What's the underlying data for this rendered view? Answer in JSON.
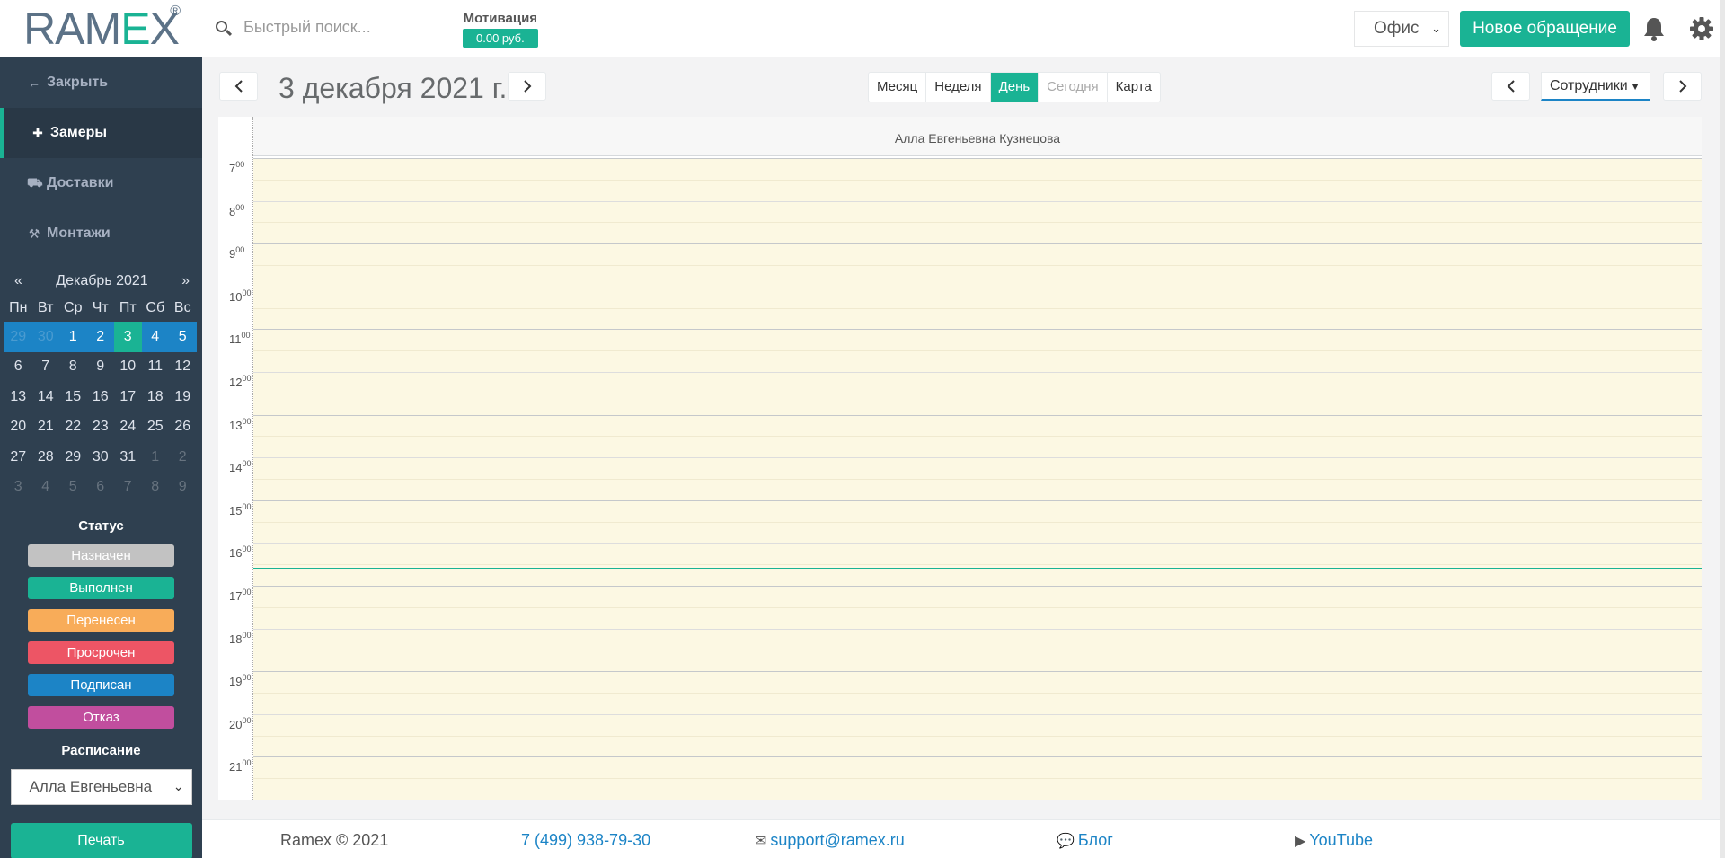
{
  "brand": {
    "logo_text": "RAMEX",
    "reg": "®"
  },
  "sidebar": {
    "nav": [
      {
        "label": "Закрыть",
        "icon": "arrow-left-icon"
      },
      {
        "label": "Замеры",
        "icon": "move-icon",
        "active": true
      },
      {
        "label": "Доставки",
        "icon": "truck-icon"
      },
      {
        "label": "Монтажи",
        "icon": "wrench-icon"
      }
    ],
    "mini_calendar": {
      "prev": "«",
      "next": "»",
      "month": "Декабрь 2021",
      "weekdays": [
        "Пн",
        "Вт",
        "Ср",
        "Чт",
        "Пт",
        "Сб",
        "Вс"
      ],
      "weeks": [
        [
          "29",
          "30",
          "1",
          "2",
          "3",
          "4",
          "5"
        ],
        [
          "6",
          "7",
          "8",
          "9",
          "10",
          "11",
          "12"
        ],
        [
          "13",
          "14",
          "15",
          "16",
          "17",
          "18",
          "19"
        ],
        [
          "20",
          "21",
          "22",
          "23",
          "24",
          "25",
          "26"
        ],
        [
          "27",
          "28",
          "29",
          "30",
          "31",
          "1",
          "2"
        ],
        [
          "3",
          "4",
          "5",
          "6",
          "7",
          "8",
          "9"
        ]
      ]
    },
    "status": {
      "title": "Статус",
      "items": [
        {
          "label": "Назначен",
          "color": "#c2c2c2"
        },
        {
          "label": "Выполнен",
          "color": "#1ab394"
        },
        {
          "label": "Перенесен",
          "color": "#f8ac59"
        },
        {
          "label": "Просрочен",
          "color": "#ed5565"
        },
        {
          "label": "Подписан",
          "color": "#1c84c6"
        },
        {
          "label": "Отказ",
          "color": "#c14e9e"
        }
      ]
    },
    "schedule": {
      "title": "Расписание",
      "selected": "Алла Евгеньевна"
    },
    "print_label": "Печать"
  },
  "topbar": {
    "search_placeholder": "Быстрый поиск...",
    "motivation": {
      "label": "Мотивация",
      "value": "0.00 руб."
    },
    "office": "Офис",
    "new_request": "Новое обращение"
  },
  "calendar": {
    "date_title": "3 декабря 2021 г.",
    "views": [
      {
        "label": "Месяц"
      },
      {
        "label": "Неделя"
      },
      {
        "label": "День",
        "active": true
      },
      {
        "label": "Сегодня",
        "disabled": true
      },
      {
        "label": "Карта"
      }
    ],
    "staff_label": "Сотрудники",
    "resource": "Алла Евгеньевна Кузнецова",
    "hours": [
      "7",
      "8",
      "9",
      "10",
      "11",
      "12",
      "13",
      "14",
      "15",
      "16",
      "17",
      "18",
      "19",
      "20",
      "21"
    ],
    "minutes_label": "00",
    "now_time": "16:35"
  },
  "footer": {
    "copyright": "Ramex © 2021",
    "phone": "7 (499) 938-79-30",
    "email": "support@ramex.ru",
    "blog": "Блог",
    "youtube": "YouTube"
  },
  "colors": {
    "accent": "#1ab394",
    "sidebar": "#2f4050",
    "blue": "#1c84c6",
    "slot_bg": "#fcf8e3"
  }
}
